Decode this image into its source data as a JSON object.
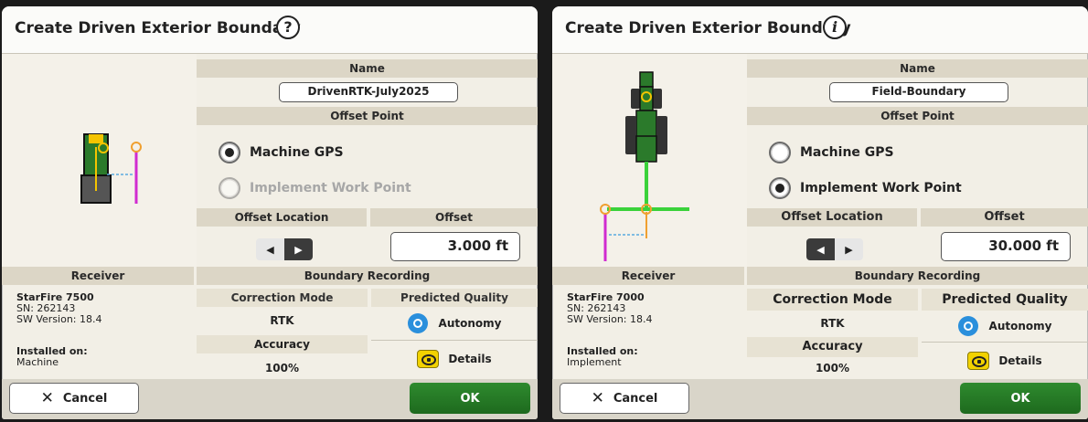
{
  "left": {
    "title": "Create Driven Exterior Boundary",
    "help_symbol": "?",
    "name_label": "Name",
    "name_value": "DrivenRTK-July2025",
    "offset_point_label": "Offset Point",
    "options": [
      {
        "label": "Machine GPS",
        "selected": true,
        "enabled": true
      },
      {
        "label": "Implement Work Point",
        "selected": false,
        "enabled": false
      }
    ],
    "offset_location_label": "Offset Location",
    "offset_label": "Offset",
    "offset_value": "3.000 ft",
    "receiver_label": "Receiver",
    "receiver_model": "StarFire 7500",
    "receiver_sn": "SN: 262143",
    "receiver_sw": "SW Version: 18.4",
    "installed_on_label": "Installed on:",
    "installed_on_value": "Machine",
    "boundary_recording_label": "Boundary Recording",
    "correction_mode_label": "Correction Mode",
    "correction_mode_value": "RTK",
    "predicted_quality_label": "Predicted Quality",
    "predicted_quality_value": "Autonomy",
    "accuracy_label": "Accuracy",
    "accuracy_value": "100%",
    "details_label": "Details",
    "cancel_label": "Cancel",
    "ok_label": "OK"
  },
  "right": {
    "title": "Create Driven Exterior Boundary",
    "info_symbol": "i",
    "name_label": "Name",
    "name_value": "Field-Boundary",
    "offset_point_label": "Offset Point",
    "options": [
      {
        "label": "Machine GPS",
        "selected": false,
        "enabled": true
      },
      {
        "label": "Implement Work Point",
        "selected": true,
        "enabled": true
      }
    ],
    "offset_location_label": "Offset Location",
    "offset_label": "Offset",
    "offset_value": "30.000 ft",
    "receiver_label": "Receiver",
    "receiver_model": "StarFire 7000",
    "receiver_sn": "SN: 262143",
    "receiver_sw": "SW Version: 18.4",
    "installed_on_label": "Installed on:",
    "installed_on_value": "Implement",
    "boundary_recording_label": "Boundary Recording",
    "correction_mode_label": "Correction Mode",
    "correction_mode_value": "RTK",
    "predicted_quality_label": "Predicted Quality",
    "predicted_quality_value": "Autonomy",
    "accuracy_label": "Accuracy",
    "accuracy_value": "100%",
    "details_label": "Details",
    "cancel_label": "Cancel",
    "ok_label": "OK"
  },
  "icons": {
    "help": "question-circle-icon",
    "info": "info-circle-icon",
    "machine_gps_diagram": "tractor-gps-offset-icon",
    "implement_diagram": "tractor-implement-offset-icon",
    "left_arrow": "triangle-left-icon",
    "right_arrow": "triangle-right-icon",
    "autonomy": "autonomy-quality-icon",
    "details": "eye-details-icon",
    "cancel": "x-icon"
  },
  "colors": {
    "brand_green": "#2e8a2e",
    "header_band": "#dcd6c6",
    "gps_yellow": "#f5c400",
    "implement_magenta": "#d02bd0",
    "offset_orange": "#f0a030",
    "autonomy_blue": "#2a8fdc"
  }
}
